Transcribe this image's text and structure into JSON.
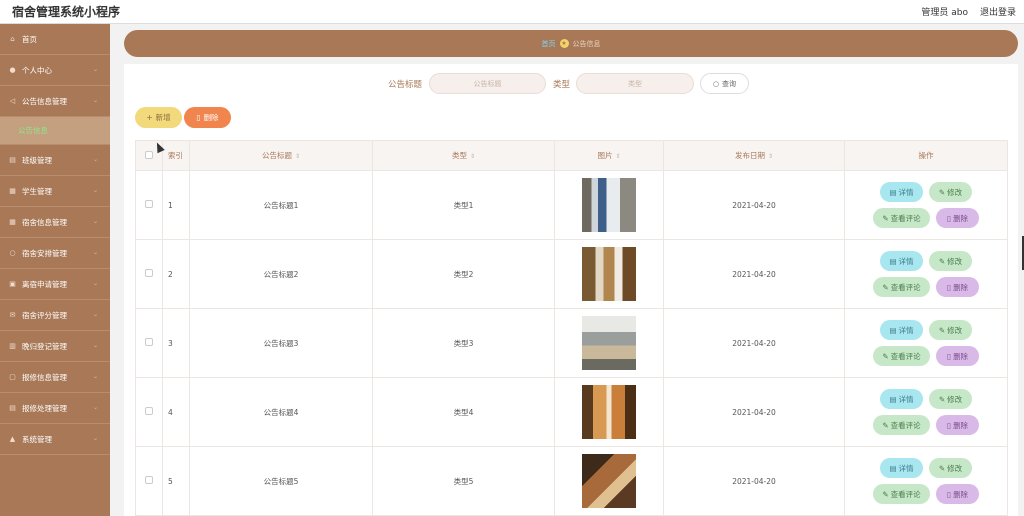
{
  "app_title": "宿舍管理系统小程序",
  "header": {
    "user_label": "管理员 abo",
    "logout_label": "退出登录"
  },
  "sidebar": {
    "items": [
      {
        "label": "首页",
        "icon": "home-icon",
        "glyph": "⌂"
      },
      {
        "label": "个人中心",
        "icon": "user-icon",
        "glyph": "●"
      },
      {
        "label": "公告信息管理",
        "icon": "megaphone-icon",
        "glyph": "◁"
      },
      {
        "label": "班级管理",
        "icon": "list-icon",
        "glyph": "▤"
      },
      {
        "label": "学生管理",
        "icon": "student-icon",
        "glyph": "▦"
      },
      {
        "label": "宿舍信息管理",
        "icon": "building-icon",
        "glyph": "▦"
      },
      {
        "label": "宿舍安排管理",
        "icon": "circle-icon",
        "glyph": "○"
      },
      {
        "label": "离宿申请管理",
        "icon": "form-icon",
        "glyph": "▣"
      },
      {
        "label": "宿舍评分管理",
        "icon": "mail-icon",
        "glyph": "✉"
      },
      {
        "label": "晚归登记管理",
        "icon": "chart-icon",
        "glyph": "▥"
      },
      {
        "label": "报修信息管理",
        "icon": "repair-icon",
        "glyph": "▢"
      },
      {
        "label": "报修处理管理",
        "icon": "tools-icon",
        "glyph": "▤"
      },
      {
        "label": "系统管理",
        "icon": "settings-icon",
        "glyph": "▲"
      }
    ],
    "active_sub": "公告信息"
  },
  "breadcrumb": {
    "home": "首页",
    "current": "公告信息"
  },
  "search": {
    "title_label": "公告标题",
    "title_placeholder": "公告标题",
    "type_label": "类型",
    "type_placeholder": "类型",
    "query_label": "查询"
  },
  "actions": {
    "add_label": "新增",
    "delete_label": "删除"
  },
  "table": {
    "headers": [
      "索引",
      "公告标题",
      "类型",
      "图片",
      "发布日期",
      "操作"
    ],
    "rows": [
      {
        "index": "1",
        "title": "公告标题1",
        "type": "类型1",
        "date": "2021-04-20"
      },
      {
        "index": "2",
        "title": "公告标题2",
        "type": "类型2",
        "date": "2021-04-20"
      },
      {
        "index": "3",
        "title": "公告标题3",
        "type": "类型3",
        "date": "2021-04-20"
      },
      {
        "index": "4",
        "title": "公告标题4",
        "type": "类型4",
        "date": "2021-04-20"
      },
      {
        "index": "5",
        "title": "公告标题5",
        "type": "类型5",
        "date": "2021-04-20"
      }
    ],
    "ops": {
      "detail": "详情",
      "edit": "修改",
      "comment": "查看评论",
      "remove": "删除"
    }
  },
  "colors": {
    "brand": "#a87857",
    "accent_green": "#8fe58a",
    "add": "#f2d97c",
    "delete": "#f0854e"
  }
}
